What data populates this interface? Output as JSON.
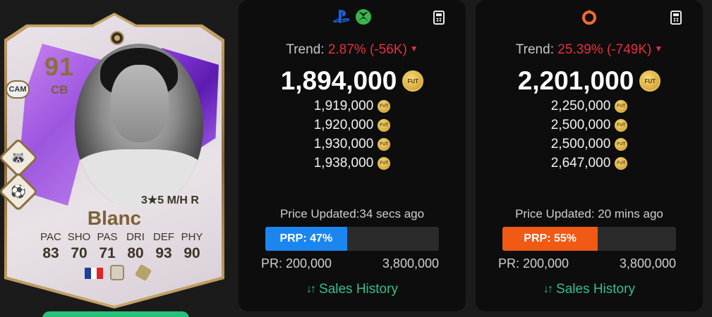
{
  "card": {
    "rating": "91",
    "position": "CB",
    "alt_position": "CAM",
    "name": "Blanc",
    "skills_line": "3★5 M/H R",
    "stat_labels": [
      "PAC",
      "SHO",
      "PAS",
      "DRI",
      "DEF",
      "PHY"
    ],
    "stat_values": [
      "83",
      "70",
      "71",
      "80",
      "93",
      "90"
    ],
    "nation_flag_colors": [
      "#1c3f9e",
      "#ffffff",
      "#e2232b"
    ]
  },
  "panels": [
    {
      "platform_icons": [
        "playstation-icon",
        "xbox-icon"
      ],
      "trend_label": "Trend:",
      "trend_value": "2.87% (-56K)",
      "main_price": "1,894,000",
      "coin_text": "FUT",
      "prices": [
        "1,919,000",
        "1,920,000",
        "1,930,000",
        "1,938,000"
      ],
      "updated": "Price Updated:34 secs ago",
      "prp_label": "PRP: 47%",
      "prp_fraction": 0.47,
      "prp_color": "#1c86f0",
      "pr_min": "PR: 200,000",
      "pr_max": "3,800,000",
      "sales_label": "Sales History"
    },
    {
      "platform_icons": [
        "origin-icon"
      ],
      "trend_label": "Trend:",
      "trend_value": "25.39% (-749K)",
      "main_price": "2,201,000",
      "coin_text": "FUT",
      "prices": [
        "2,250,000",
        "2,500,000",
        "2,500,000",
        "2,647,000"
      ],
      "updated": "Price Updated: 20 mins ago",
      "prp_label": "PRP: 55%",
      "prp_fraction": 0.55,
      "prp_color": "#f05a14",
      "pr_min": "PR: 200,000",
      "pr_max": "3,800,000",
      "sales_label": "Sales History"
    }
  ],
  "colors": {
    "trend_down": "#e3303f",
    "sales_link": "#33c08a",
    "card_gold": "#8b6e3e"
  }
}
